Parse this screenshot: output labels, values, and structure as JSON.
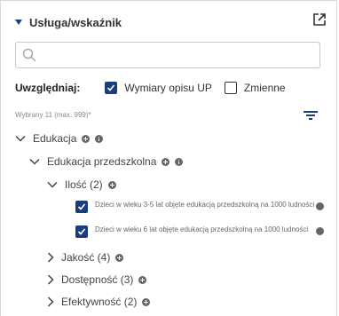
{
  "panel": {
    "title": "Usługa/wskaźnik",
    "search_placeholder": "",
    "include_label": "Uwzględniaj:",
    "options": [
      {
        "label": "Wymiary opisu UP",
        "checked": true
      },
      {
        "label": "Zmienne",
        "checked": false
      }
    ],
    "selected_text": "Wybrany 11 (max. 999)*",
    "tree": {
      "level1": "Edukacja",
      "level2": "Edukacja przedszkolna",
      "level3_open": "Ilość (2)",
      "leaves": [
        "Dzieci w wieku 3-5 lat objęte edukacją przedszkolną na 1000 ludności",
        "Dzieci w wieku 6 lat objęte edukacją przedszkolną na 1000 ludności"
      ],
      "collapsed": [
        "Jakość (4)",
        "Dostępność (3)",
        "Efektywność (2)"
      ]
    }
  },
  "colors": {
    "accent": "#1a3d7c"
  }
}
